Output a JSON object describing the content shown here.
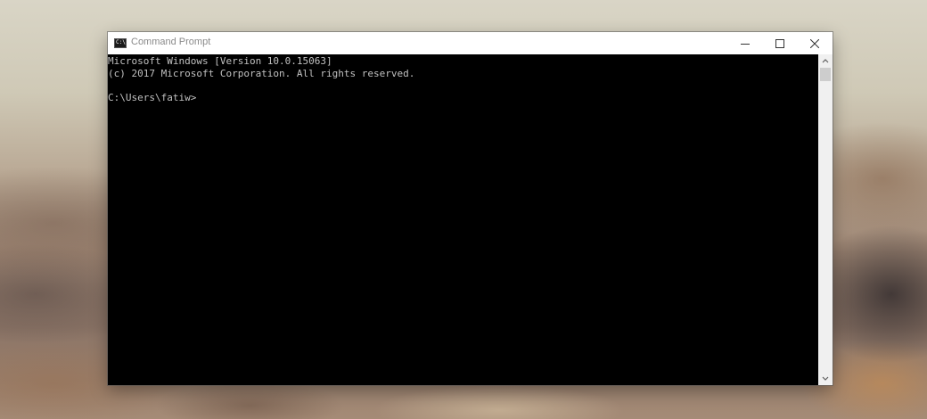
{
  "window": {
    "title": "Command Prompt",
    "app_icon_glyph": "C:\\",
    "icons": {
      "app": "command-prompt-icon",
      "minimize": "minimize-icon",
      "maximize": "maximize-icon",
      "close": "close-icon",
      "scroll_up": "chevron-up-icon",
      "scroll_down": "chevron-down-icon"
    }
  },
  "terminal": {
    "lines": [
      "Microsoft Windows [Version 10.0.15063]",
      "(c) 2017 Microsoft Corporation. All rights reserved.",
      "",
      "C:\\Users\\fatiw>"
    ],
    "text_color": "#c0c0c0",
    "background_color": "#000000"
  },
  "colors": {
    "titlebar_bg": "#ffffff",
    "title_text": "#8a8a8a",
    "scrollbar_track": "#f0f0f0",
    "scrollbar_thumb": "#cdcdcd"
  }
}
